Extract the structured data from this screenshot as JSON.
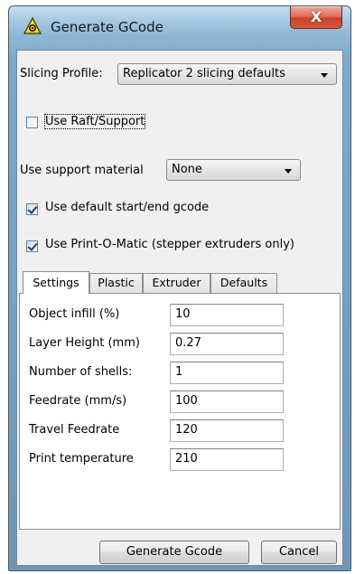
{
  "window": {
    "title": "Generate GCode",
    "close_label": "X",
    "title_icon": "warning-triangle-icon"
  },
  "profile": {
    "label": "Slicing Profile:",
    "value": "Replicator 2 slicing defaults"
  },
  "raft": {
    "label": "Use Raft/Support",
    "checked": false
  },
  "support": {
    "label": "Use support material",
    "value": "None"
  },
  "default_gcode": {
    "label": "Use default start/end gcode",
    "checked": true
  },
  "printomatic": {
    "label": "Use Print-O-Matic (stepper extruders only)",
    "checked": true
  },
  "tabs": [
    "Settings",
    "Plastic",
    "Extruder",
    "Defaults"
  ],
  "active_tab": "Settings",
  "settings": [
    {
      "label": "Object infill (%)",
      "value": "10"
    },
    {
      "label": "Layer Height (mm)",
      "value": "0.27"
    },
    {
      "label": "Number of shells:",
      "value": "1"
    },
    {
      "label": "Feedrate (mm/s)",
      "value": "100"
    },
    {
      "label": "Travel Feedrate",
      "value": "120"
    },
    {
      "label": "Print temperature",
      "value": "210"
    }
  ],
  "buttons": {
    "generate": "Generate Gcode",
    "cancel": "Cancel"
  }
}
